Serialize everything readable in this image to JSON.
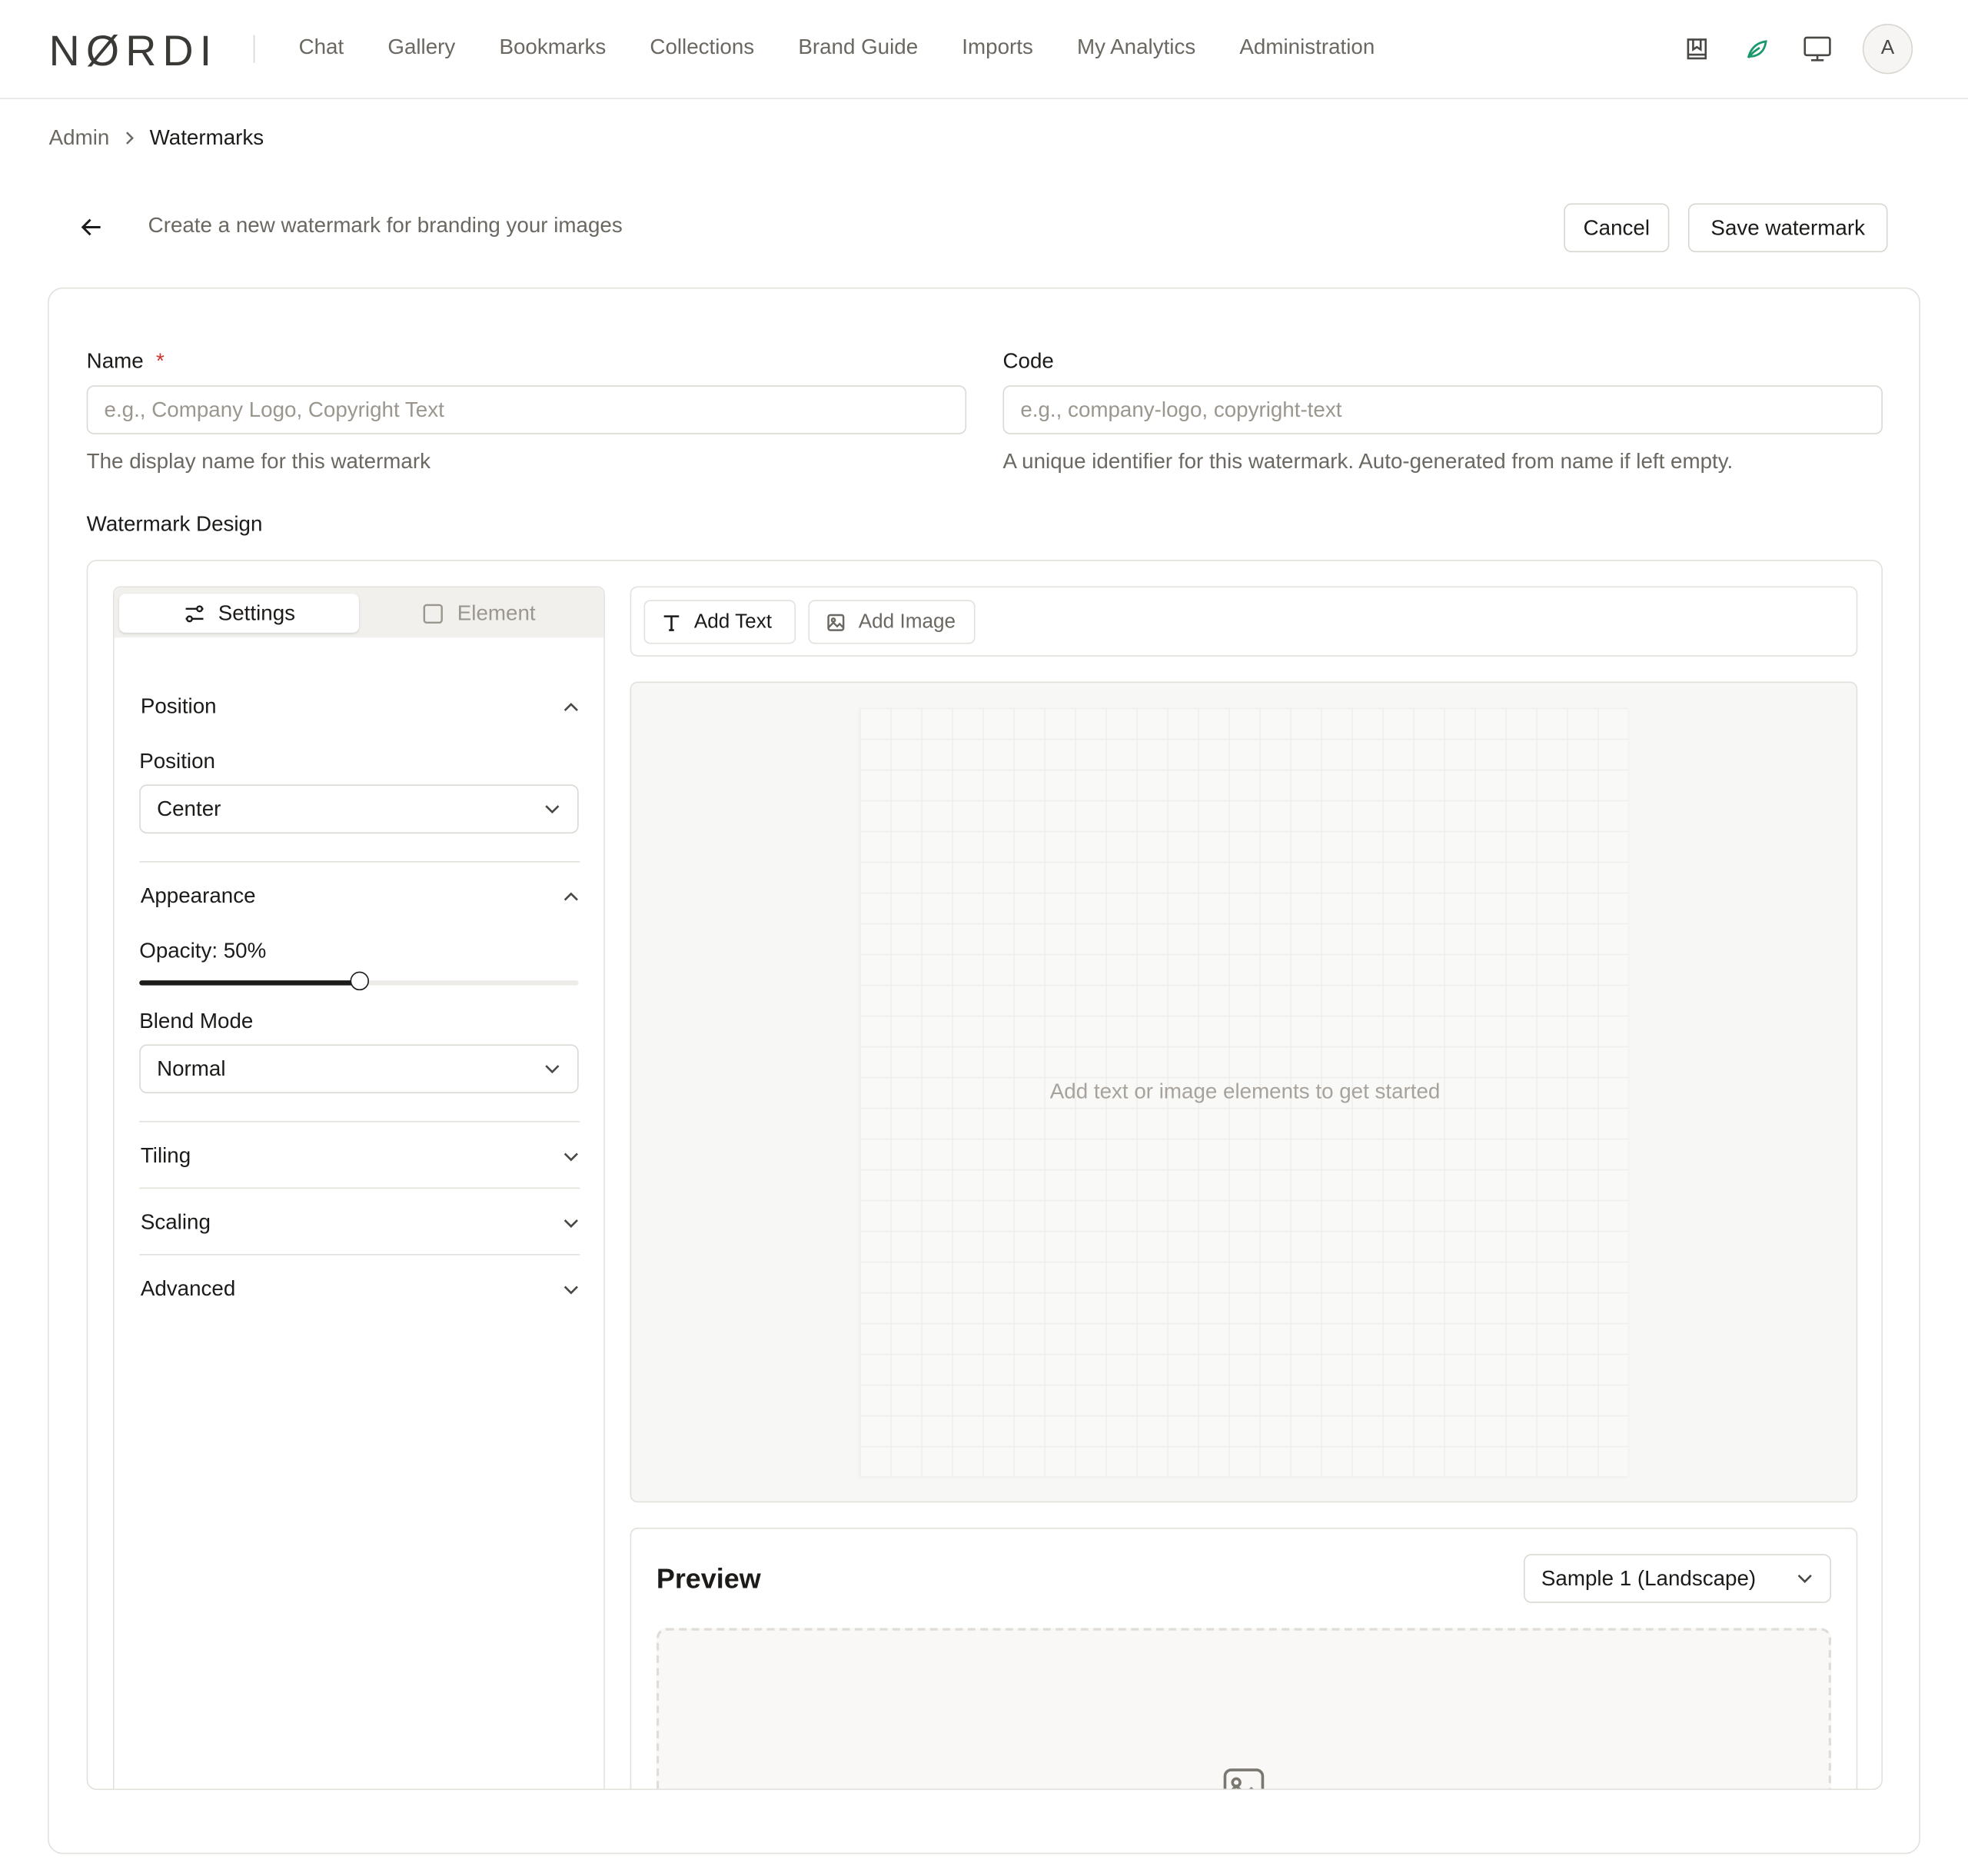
{
  "brand": {
    "logo": "NØRDI"
  },
  "nav": {
    "items": [
      "Chat",
      "Gallery",
      "Bookmarks",
      "Collections",
      "Brand Guide",
      "Imports",
      "My Analytics",
      "Administration"
    ]
  },
  "header_icons": [
    "bookmark-book-icon",
    "leaf-icon",
    "monitor-icon"
  ],
  "user": {
    "avatar_initial": "A"
  },
  "colors": {
    "accent_leaf": "#1a9a6c",
    "required": "#d0312d"
  },
  "breadcrumb": {
    "root": "Admin",
    "current": "Watermarks"
  },
  "page": {
    "subtitle": "Create a new watermark for branding your images",
    "cancel": "Cancel",
    "save": "Save watermark"
  },
  "form": {
    "name_label": "Name",
    "name_required": "*",
    "name_placeholder": "e.g., Company Logo, Copyright Text",
    "name_help": "The display name for this watermark",
    "code_label": "Code",
    "code_placeholder": "e.g., company-logo, copyright-text",
    "code_help": "A unique identifier for this watermark. Auto-generated from name if left empty.",
    "design_label": "Watermark Design"
  },
  "panel": {
    "tabs": {
      "settings": "Settings",
      "element": "Element"
    },
    "position": {
      "header": "Position",
      "field_label": "Position",
      "value": "Center"
    },
    "appearance": {
      "header": "Appearance",
      "opacity_label": "Opacity: 50%",
      "opacity_value": 0.5,
      "blend_label": "Blend Mode",
      "blend_value": "Normal"
    },
    "tiling": "Tiling",
    "scaling": "Scaling",
    "advanced": "Advanced"
  },
  "toolbar": {
    "add_text": "Add Text",
    "add_image": "Add Image"
  },
  "canvas": {
    "empty_message": "Add text or image elements to get started"
  },
  "preview": {
    "title": "Preview",
    "sample": "Sample 1 (Landscape)"
  }
}
